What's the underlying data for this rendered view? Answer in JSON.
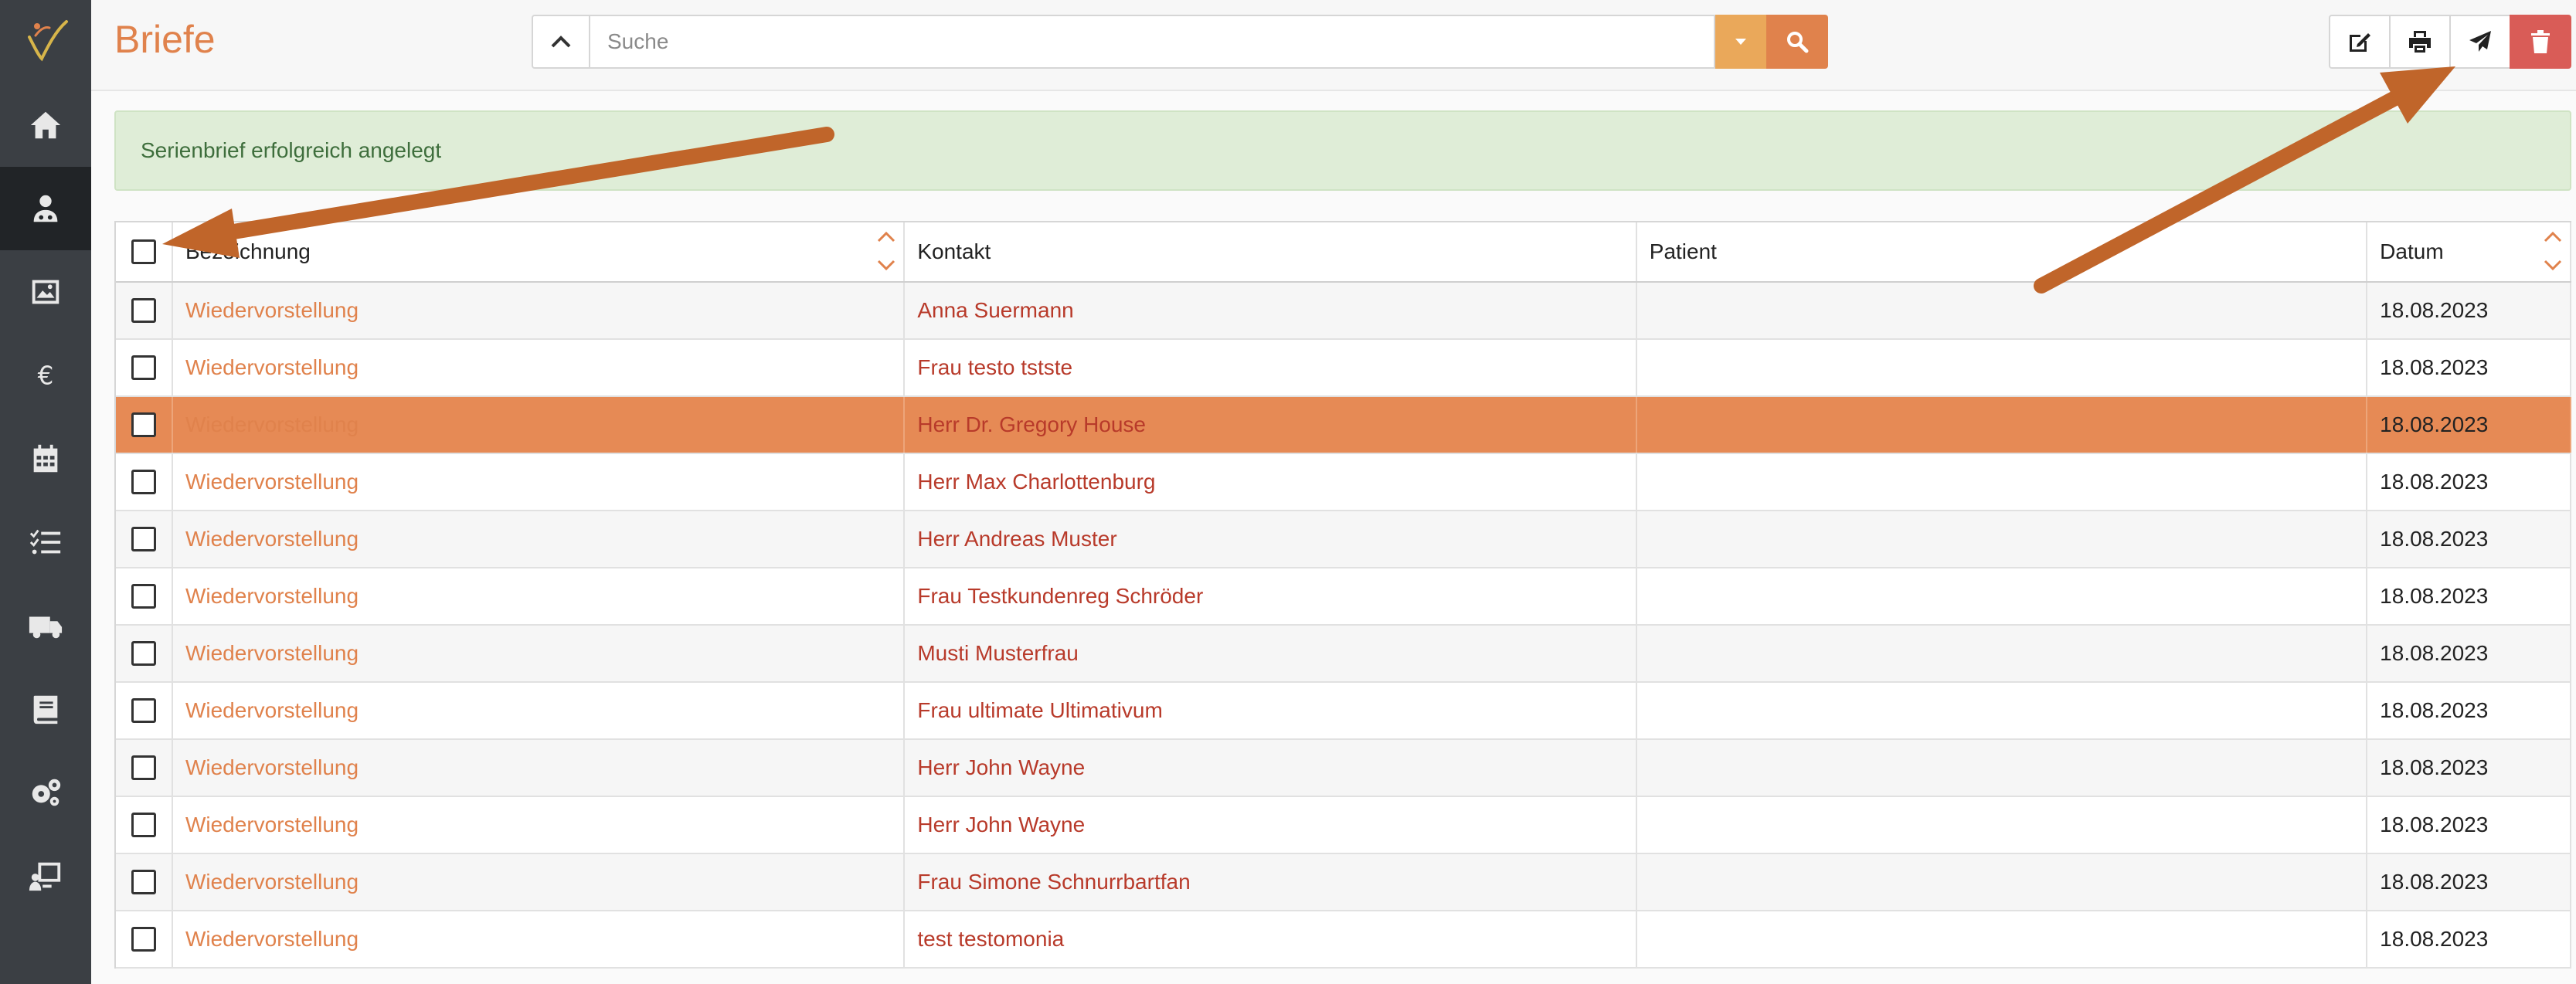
{
  "app": {
    "title": "Briefe"
  },
  "search": {
    "placeholder": "Suche",
    "value": ""
  },
  "alert": {
    "text": "Serienbrief erfolgreich angelegt"
  },
  "sidebar": {
    "items": [
      {
        "icon": "home-icon"
      },
      {
        "icon": "patients-icon",
        "active": true
      },
      {
        "icon": "image-icon"
      },
      {
        "icon": "euro-icon"
      },
      {
        "icon": "calendar-icon"
      },
      {
        "icon": "tasks-icon"
      },
      {
        "icon": "truck-icon"
      },
      {
        "icon": "book-icon"
      },
      {
        "icon": "settings-icon"
      },
      {
        "icon": "presentation-icon"
      }
    ]
  },
  "toolbar": {
    "buttons": [
      "edit-icon",
      "print-icon",
      "send-icon",
      "trash-icon"
    ]
  },
  "table": {
    "headers": {
      "bezeichnung": "Bezeichnung",
      "kontakt": "Kontakt",
      "patient": "Patient",
      "datum": "Datum"
    },
    "rows": [
      {
        "bezeichnung": "Wiedervorstellung",
        "kontakt": "Anna Suermann",
        "patient": "",
        "datum": "18.08.2023"
      },
      {
        "bezeichnung": "Wiedervorstellung",
        "kontakt": "Frau testo tstste",
        "patient": "",
        "datum": "18.08.2023"
      },
      {
        "bezeichnung": "Wiedervorstellung",
        "kontakt": "Herr Dr. Gregory House",
        "patient": "",
        "datum": "18.08.2023"
      },
      {
        "bezeichnung": "Wiedervorstellung",
        "kontakt": "Herr Max Charlottenburg",
        "patient": "",
        "datum": "18.08.2023"
      },
      {
        "bezeichnung": "Wiedervorstellung",
        "kontakt": "Herr Andreas Muster",
        "patient": "",
        "datum": "18.08.2023"
      },
      {
        "bezeichnung": "Wiedervorstellung",
        "kontakt": "Frau Testkundenreg Schröder",
        "patient": "",
        "datum": "18.08.2023"
      },
      {
        "bezeichnung": "Wiedervorstellung",
        "kontakt": "Musti Musterfrau",
        "patient": "",
        "datum": "18.08.2023"
      },
      {
        "bezeichnung": "Wiedervorstellung",
        "kontakt": "Frau ultimate Ultimativum",
        "patient": "",
        "datum": "18.08.2023"
      },
      {
        "bezeichnung": "Wiedervorstellung",
        "kontakt": "Herr John Wayne",
        "patient": "",
        "datum": "18.08.2023"
      },
      {
        "bezeichnung": "Wiedervorstellung",
        "kontakt": "Herr John Wayne",
        "patient": "",
        "datum": "18.08.2023"
      },
      {
        "bezeichnung": "Wiedervorstellung",
        "kontakt": "Frau Simone Schnurrbartfan",
        "patient": "",
        "datum": "18.08.2023"
      },
      {
        "bezeichnung": "Wiedervorstellung",
        "kontakt": "test testomonia",
        "patient": "",
        "datum": "18.08.2023"
      }
    ],
    "selected_row": 2
  },
  "colors": {
    "accent": "#e0824c",
    "sidebar": "#3b3f44",
    "alert_bg": "#dfedd7",
    "arrow": "#c0652a"
  }
}
